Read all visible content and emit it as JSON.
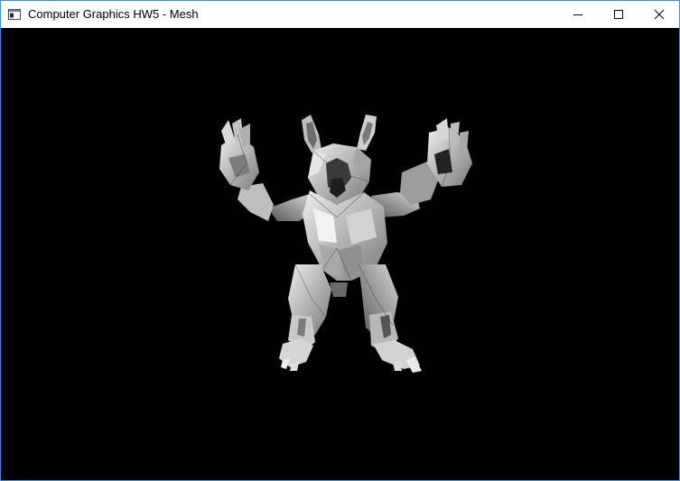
{
  "window": {
    "title": "Computer Graphics HW5 - Mesh",
    "controls": {
      "minimize_icon": "minimize-icon",
      "maximize_icon": "maximize-icon",
      "close_icon": "close-icon"
    }
  },
  "viewport": {
    "background_color": "#000000",
    "mesh_color": "#c8c8c8"
  }
}
